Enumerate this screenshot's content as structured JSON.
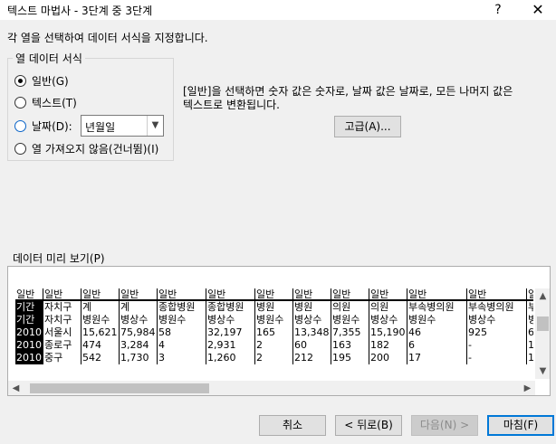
{
  "window": {
    "title": "텍스트 마법사 - 3단계 중 3단계",
    "help_label": "?",
    "close_label": "✕"
  },
  "description": "각 열을 선택하여 데이터 서식을 지정합니다.",
  "column_format": {
    "legend": "열 데이터 서식",
    "options": [
      {
        "label": "일반(G)",
        "checked": true
      },
      {
        "label": "텍스트(T)",
        "checked": false
      },
      {
        "label": "날짜(D):",
        "checked": false
      },
      {
        "label": "열 가져오지 않음(건너뜀)(I)",
        "checked": false
      }
    ],
    "date_format_value": "년월일"
  },
  "info_text_line1": "[일반]을 선택하면 숫자 값은 숫자로, 날짜 값은 날짜로, 모든 나머지 값은",
  "info_text_line2": "텍스트로 변환됩니다.",
  "advanced_button": "고급(A)...",
  "preview": {
    "label": "데이터 미리 보기(P)",
    "columns": [
      {
        "header": "일반",
        "cells": [
          "기간",
          "기간",
          "2010",
          "2010",
          "2010"
        ]
      },
      {
        "header": "일반",
        "cells": [
          "자치구",
          "자치구",
          "서울시",
          "종로구",
          "중구"
        ]
      },
      {
        "header": "일반",
        "cells": [
          "계",
          "병원수",
          "15,621",
          "474",
          "542"
        ]
      },
      {
        "header": "일반",
        "cells": [
          "계",
          "병상수",
          "75,984",
          "3,284",
          "1,730"
        ]
      },
      {
        "header": "일반",
        "cells": [
          "종합병원",
          "병원수",
          "58",
          "4",
          "3"
        ]
      },
      {
        "header": "일반",
        "cells": [
          "종합병원",
          "병상수",
          "32,197",
          "2,931",
          "1,260"
        ]
      },
      {
        "header": "일반",
        "cells": [
          "병원",
          "병원수",
          "165",
          "2",
          "2"
        ]
      },
      {
        "header": "일반",
        "cells": [
          "병원",
          "병상수",
          "13,348",
          "60",
          "212"
        ]
      },
      {
        "header": "일반",
        "cells": [
          "의원",
          "병원수",
          "7,355",
          "163",
          "195"
        ]
      },
      {
        "header": "일반",
        "cells": [
          "의원",
          "병상수",
          "15,190",
          "182",
          "200"
        ]
      },
      {
        "header": "일반",
        "cells": [
          "부속병의원",
          "병원수",
          "46",
          "6",
          "17"
        ]
      },
      {
        "header": "일반",
        "cells": [
          "부속병의원",
          "병상수",
          "925",
          "-",
          "-"
        ]
      },
      {
        "header": "일",
        "cells": [
          "부",
          "병",
          "6",
          "1",
          "1"
        ]
      }
    ]
  },
  "buttons": {
    "cancel": "취소",
    "back": "< 뒤로(B)",
    "next": "다음(N) >",
    "finish": "마침(F)"
  },
  "colors": {
    "accent": "#0078d7",
    "dialog_bg": "#f0f0f0"
  }
}
